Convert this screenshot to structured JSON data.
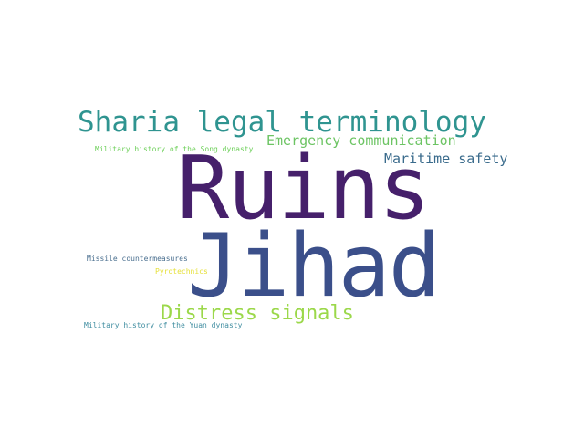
{
  "words": [
    {
      "text": "Ruins",
      "color": "#46206b"
    },
    {
      "text": "Jihad",
      "color": "#3b4f8a"
    },
    {
      "text": "Sharia legal terminology",
      "color": "#2f9490"
    },
    {
      "text": "Emergency communication",
      "color": "#6cc463"
    },
    {
      "text": "Maritime safety",
      "color": "#3a6b8c"
    },
    {
      "text": "Distress signals",
      "color": "#9bd84a"
    },
    {
      "text": "Military history of the Song dynasty",
      "color": "#6ed05a"
    },
    {
      "text": "Missile countermeasures",
      "color": "#4a6f8f"
    },
    {
      "text": "Pyrotechnics",
      "color": "#e6e03a"
    },
    {
      "text": "Military history of the Yuan dynasty",
      "color": "#3f8da0"
    }
  ]
}
